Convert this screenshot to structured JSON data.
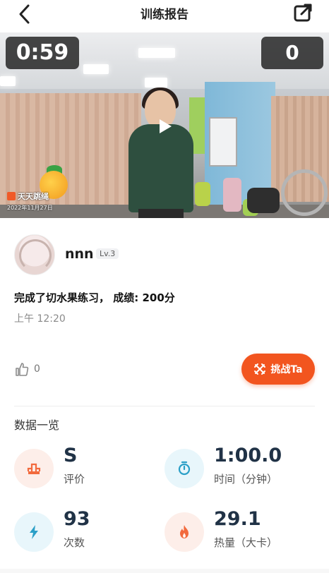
{
  "header": {
    "title": "训练报告",
    "back_icon": "chevron-left-icon",
    "edit_icon": "external-link-icon"
  },
  "video": {
    "timer": "0:59",
    "score": "0",
    "brand": "天天跳绳",
    "date_stamp": "2022年11月27日"
  },
  "post": {
    "username": "nnn",
    "level": "Lv.3",
    "description": "完成了切水果练习， 成绩: 200分",
    "time": "上午 12:20",
    "likes": "0",
    "challenge_label": "挑战Ta"
  },
  "stats": {
    "title": "数据一览",
    "items": [
      {
        "value": "S",
        "label": "评价",
        "icon": "podium-icon",
        "color": "#f26a3d",
        "bg": "#fdeee9"
      },
      {
        "value": "1:00.0",
        "label": "时间（分钟）",
        "icon": "stopwatch-icon",
        "color": "#2b9fc7",
        "bg": "#e8f6fb"
      },
      {
        "value": "93",
        "label": "次数",
        "icon": "lightning-icon",
        "color": "#2b9fc7",
        "bg": "#e8f6fb"
      },
      {
        "value": "29.1",
        "label": "热量（大卡）",
        "icon": "flame-icon",
        "color": "#f26a3d",
        "bg": "#fdeee9"
      }
    ]
  },
  "colors": {
    "accent": "#f2551f",
    "stat_value": "#203246"
  }
}
